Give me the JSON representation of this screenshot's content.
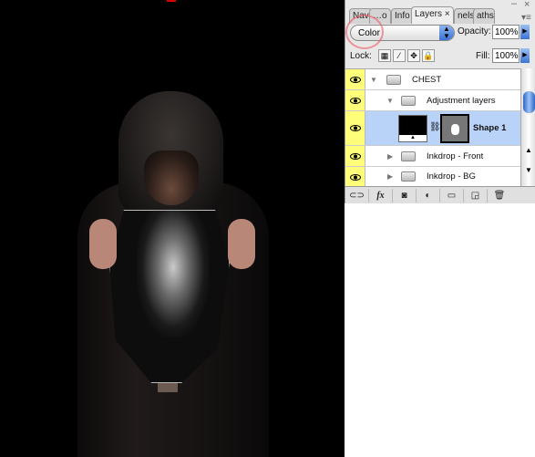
{
  "panel": {
    "tabs": [
      {
        "label": "Nav",
        "active": false
      },
      {
        "label": "o",
        "active": false
      },
      {
        "label": "Info",
        "active": false
      },
      {
        "label": "Layers",
        "active": true
      },
      {
        "label": "nels",
        "active": false
      },
      {
        "label": "aths",
        "active": false
      }
    ],
    "blend_mode": "Color",
    "opacity_label": "Opacity:",
    "opacity_value": "100%",
    "lock_label": "Lock:",
    "fill_label": "Fill:",
    "fill_value": "100%",
    "layers": [
      {
        "name": "CHEST",
        "type": "group",
        "expanded": true,
        "visible": true
      },
      {
        "name": "Adjustment layers",
        "type": "group",
        "expanded": true,
        "visible": true
      },
      {
        "name": "Shape 1",
        "type": "shape",
        "selected": true,
        "visible": true
      },
      {
        "name": "Inkdrop - Front",
        "type": "group",
        "expanded": false,
        "visible": true
      },
      {
        "name": "Inkdrop - BG",
        "type": "group",
        "expanded": false,
        "visible": true
      }
    ],
    "bottom_buttons": [
      "link-icon",
      "fx-icon",
      "mask-icon",
      "adjustment-icon",
      "folder-icon",
      "new-layer-icon",
      "trash-icon"
    ],
    "fx_label": "fx",
    "colors": {
      "selected_row": "#b9d2f7",
      "eye_column": "#fefe7a",
      "accent": "#3b73d6"
    }
  }
}
